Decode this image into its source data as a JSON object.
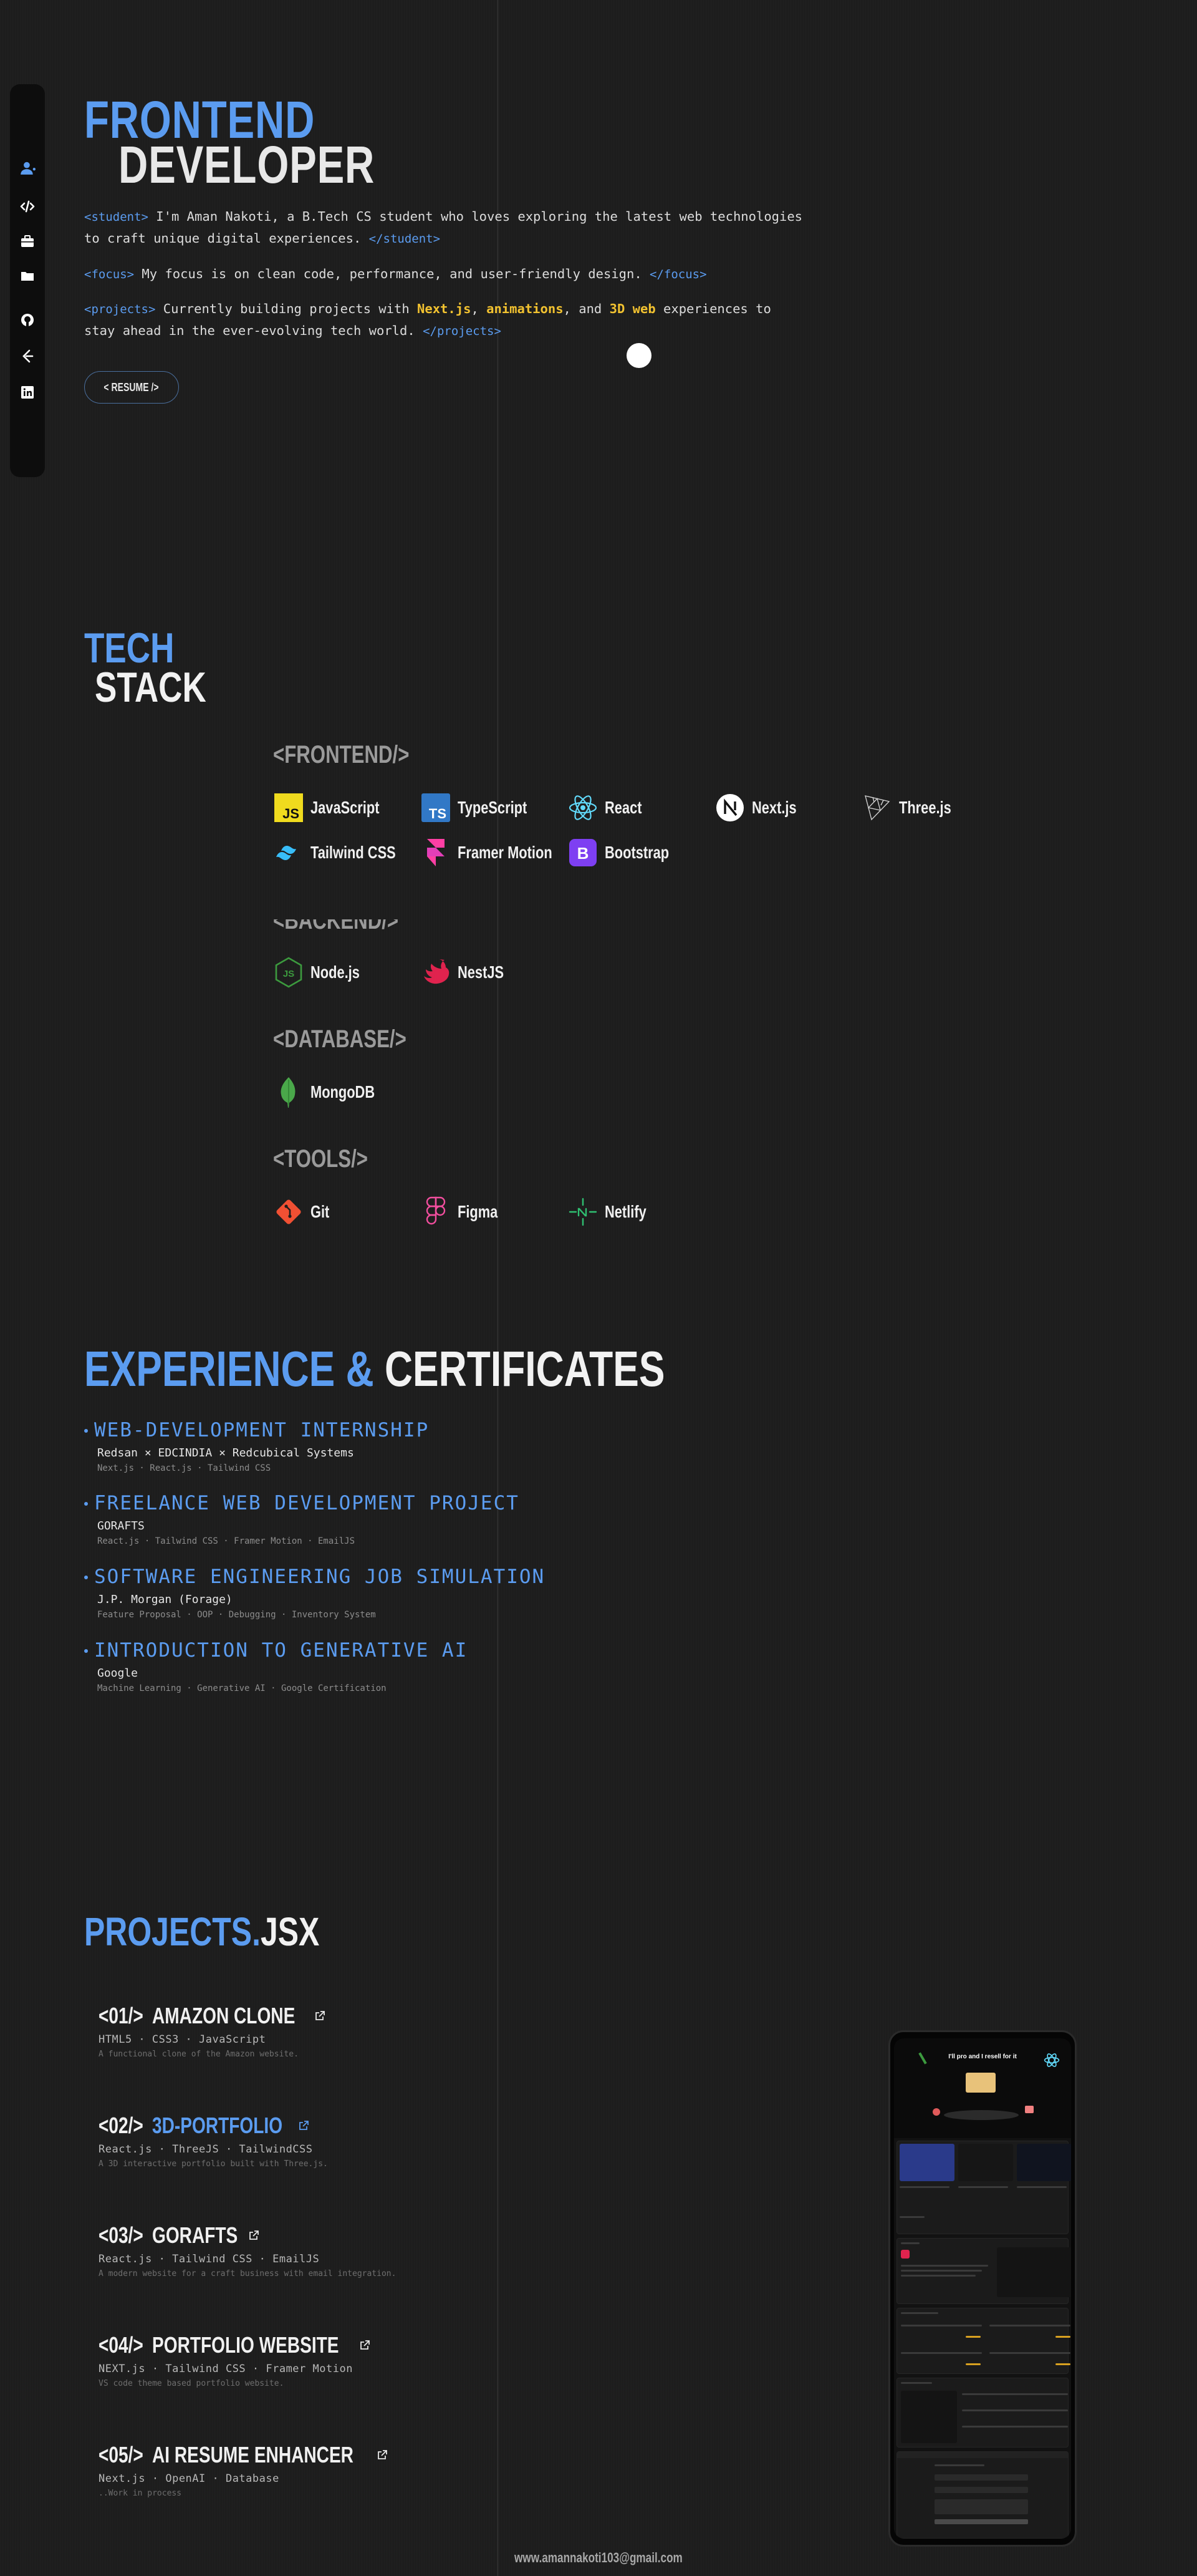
{
  "hero": {
    "title_line1": "FRONTEND",
    "title_line2": "DEVELOPER",
    "student_open": "<student>",
    "student_text": "I'm Aman Nakoti, a B.Tech CS student who loves exploring the latest web technologies to craft unique digital experiences.",
    "student_close": "</student>",
    "focus_open": "<focus>",
    "focus_text": "My focus is on clean code, performance, and user-friendly design.",
    "focus_close": "</focus>",
    "projects_open": "<projects>",
    "projects_pre": "Currently building projects with",
    "hl1": "Next.js",
    "hl2": "animations",
    "projects_and": ", and",
    "hl3": "3D web",
    "projects_post": "experiences to stay ahead in the ever-evolving tech world.",
    "projects_close": "</projects>",
    "resume_label": "< RESUME />"
  },
  "sidebar": {
    "items": [
      {
        "icon": "user-icon"
      },
      {
        "icon": "code-icon"
      },
      {
        "icon": "briefcase-icon"
      },
      {
        "icon": "folder-icon"
      },
      {
        "icon": "github-icon"
      },
      {
        "icon": "leetcode-icon"
      },
      {
        "icon": "linkedin-icon"
      }
    ]
  },
  "tech_stack": {
    "title_1": "TECH",
    "title_2": "STACK",
    "frontend_head": "<FRONTEND/>",
    "backend_head": "<BACKEND/>",
    "database_head": "<DATABASE/>",
    "tools_head": "<TOOLS/>",
    "frontend": [
      "JavaScript",
      "TypeScript",
      "React",
      "Next.js",
      "Three.js",
      "Tailwind CSS",
      "Framer Motion",
      "Bootstrap"
    ],
    "backend": [
      "Node.js",
      "NestJS"
    ],
    "database": [
      "MongoDB"
    ],
    "tools": [
      "Git",
      "Figma",
      "Netlify"
    ],
    "colors": {
      "javascript": "#f0db1e",
      "typescript": "#3178c6",
      "react": "#61dafb",
      "tailwind": "#38bdf8",
      "framer": "#ff3fa4",
      "bootstrap": "#7e3ff2",
      "node": "#3c9a3e",
      "nest": "#e0234e",
      "mongo": "#4aa84a",
      "git": "#f05033",
      "figma": "#f24e9e",
      "netlify": "#2fbf71"
    }
  },
  "experience": {
    "title_1": "EXPERIENCE &",
    "title_2": "CERTIFICATES",
    "items": [
      {
        "title": "WEB-DEVELOPMENT INTERNSHIP",
        "org": "Redsan × EDCINDIA × Redcubical Systems",
        "tags": "Next.js · React.js · Tailwind CSS"
      },
      {
        "title": "FREELANCE WEB DEVELOPMENT PROJECT",
        "org": "GORAFTS",
        "tags": "React.js · Tailwind CSS · Framer Motion · EmailJS"
      },
      {
        "title": "SOFTWARE ENGINEERING JOB SIMULATION",
        "org": "J.P. Morgan (Forage)",
        "tags": "Feature Proposal · OOP · Debugging · Inventory System"
      },
      {
        "title": "INTRODUCTION TO GENERATIVE AI",
        "org": "Google",
        "tags": "Machine Learning · Generative AI · Google Certification"
      }
    ]
  },
  "projects": {
    "title_1": "PROJECTS.",
    "title_2": "JSX",
    "items": [
      {
        "num": "<01/>",
        "name": "AMAZON CLONE",
        "tech": "HTML5 · CSS3 · JavaScript",
        "desc": "A functional clone of the Amazon website."
      },
      {
        "num": "<02/>",
        "name": "3D-PORTFOLIO",
        "tech": "React.js · ThreeJS · TailwindCSS",
        "desc": "A 3D interactive portfolio built with Three.js."
      },
      {
        "num": "<03/>",
        "name": "GORAFTS",
        "tech": "React.js · Tailwind CSS · EmailJS",
        "desc": "A modern website for a craft business with email integration."
      },
      {
        "num": "<04/>",
        "name": "PORTFOLIO WEBSITE",
        "tech": "NEXT.js · Tailwind CSS · Framer Motion",
        "desc": "VS code theme based portfolio website."
      },
      {
        "num": "<05/>",
        "name": "AI RESUME ENHANCER",
        "tech": "Next.js · OpenAI · Database",
        "desc": "..Work in process"
      }
    ],
    "preview_heading": "I'll pro and I resell for it"
  },
  "footer": {
    "email": "www.amannakoti103@gmail.com"
  }
}
